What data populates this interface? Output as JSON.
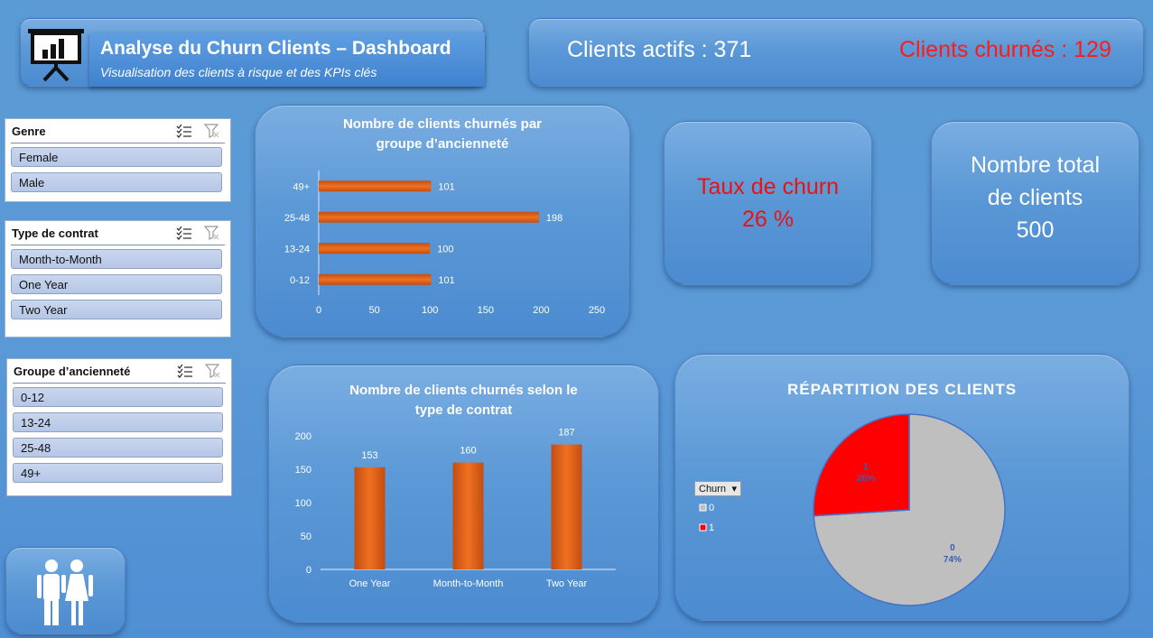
{
  "header": {
    "title": "Analyse du Churn Clients – Dashboard",
    "subtitle": "Visualisation des clients à risque et des KPIs clés",
    "logo_icon": "presentation-chart-icon"
  },
  "kpis": {
    "clients_actifs": "Clients actifs : 371",
    "clients_churnes": "Clients churnés : 129",
    "taux_label": "Taux de churn",
    "taux_value": "26 %",
    "total_line1": "Nombre total",
    "total_line2": "de clients",
    "total_value": "500"
  },
  "slicers": {
    "genre": {
      "title": "Genre",
      "items": [
        "Female",
        "Male"
      ]
    },
    "contrat": {
      "title": "Type de contrat",
      "items": [
        "Month-to-Month",
        "One Year",
        "Two Year"
      ]
    },
    "anciennete": {
      "title": "Groupe d’ancienneté",
      "items": [
        "0-12",
        "13-24",
        "25-48",
        "49+"
      ]
    }
  },
  "colors": {
    "bar": "#e8651c",
    "churn_red": "#ff0000",
    "pie_grey": "#bfbfbf",
    "accent_blue": "#5b9bd5"
  },
  "chart_data": [
    {
      "type": "bar",
      "orientation": "horizontal",
      "title": "Nombre de clients churnés par groupe d’ancienneté",
      "title_line1": "Nombre de clients churnés par",
      "title_line2": "groupe d’ancienneté",
      "categories": [
        "0-12",
        "13-24",
        "25-48",
        "49+"
      ],
      "values": [
        101,
        100,
        198,
        101
      ],
      "xlim": [
        0,
        250
      ],
      "xticks": [
        "0",
        "50",
        "100",
        "150",
        "200",
        "250"
      ]
    },
    {
      "type": "bar",
      "orientation": "vertical",
      "title": "Nombre de clients churnés selon le type de contrat",
      "title_line1": "Nombre de clients churnés selon le",
      "title_line2": "type de contrat",
      "categories": [
        "One Year",
        "Month-to-Month",
        "Two Year"
      ],
      "values": [
        153,
        160,
        187
      ],
      "ylim": [
        0,
        200
      ],
      "yticks": [
        "0",
        "50",
        "100",
        "150",
        "200"
      ]
    },
    {
      "type": "pie",
      "title": "RÉPARTITION DES CLIENTS",
      "legend_title": "Churn",
      "slices": [
        {
          "label": "0",
          "percent": "74%",
          "value": 74,
          "color": "#bfbfbf"
        },
        {
          "label": "1",
          "percent": "26%",
          "value": 26,
          "color": "#ff0000"
        }
      ]
    }
  ]
}
